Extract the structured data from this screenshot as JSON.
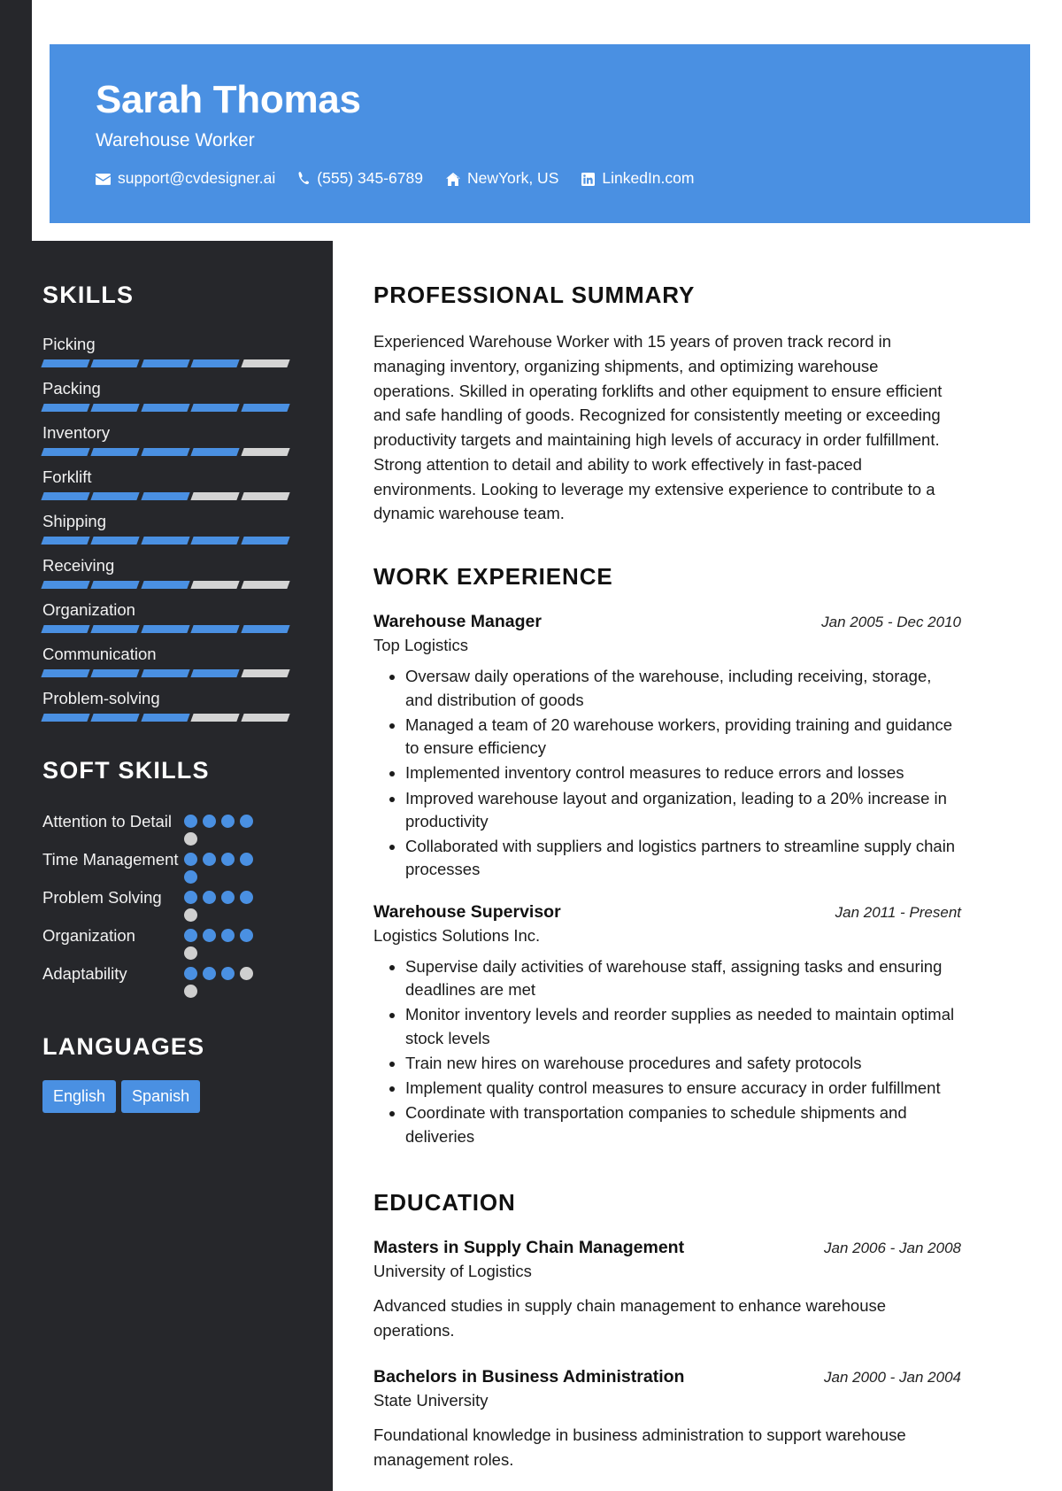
{
  "theme": {
    "accent": "#4a90e2",
    "sidebar_bg": "#26272b",
    "sheet_bg": "#ffffff",
    "bar_empty": "#d4d4d4",
    "dot_empty": "#cfcfcf"
  },
  "header": {
    "name": "Sarah Thomas",
    "role": "Warehouse Worker",
    "contacts": [
      {
        "icon": "envelope-icon",
        "text": "support@cvdesigner.ai"
      },
      {
        "icon": "phone-icon",
        "text": "(555) 345-6789"
      },
      {
        "icon": "home-icon",
        "text": "NewYork, US"
      },
      {
        "icon": "linkedin-icon",
        "text": "LinkedIn.com"
      }
    ]
  },
  "sidebar": {
    "skills_title": "SKILLS",
    "skills": [
      {
        "name": "Picking",
        "level": 4,
        "max": 5
      },
      {
        "name": "Packing",
        "level": 5,
        "max": 5
      },
      {
        "name": "Inventory",
        "level": 4,
        "max": 5
      },
      {
        "name": "Forklift",
        "level": 3,
        "max": 5
      },
      {
        "name": "Shipping",
        "level": 5,
        "max": 5
      },
      {
        "name": "Receiving",
        "level": 3,
        "max": 5
      },
      {
        "name": "Organization",
        "level": 5,
        "max": 5
      },
      {
        "name": "Communication",
        "level": 4,
        "max": 5
      },
      {
        "name": "Problem-solving",
        "level": 3,
        "max": 5
      }
    ],
    "soft_skills_title": "SOFT SKILLS",
    "soft_skills": [
      {
        "name": "Attention to Detail",
        "level": 4,
        "max": 5
      },
      {
        "name": "Time Management",
        "level": 5,
        "max": 5
      },
      {
        "name": "Problem Solving",
        "level": 4,
        "max": 5
      },
      {
        "name": "Organization",
        "level": 4,
        "max": 5
      },
      {
        "name": "Adaptability",
        "level": 3,
        "max": 5
      }
    ],
    "languages_title": "LANGUAGES",
    "languages": [
      "English",
      "Spanish"
    ]
  },
  "main": {
    "summary_title": "PROFESSIONAL SUMMARY",
    "summary_text": "Experienced Warehouse Worker with 15 years of proven track record in managing inventory, organizing shipments, and optimizing warehouse operations. Skilled in operating forklifts and other equipment to ensure efficient and safe handling of goods. Recognized for consistently meeting or exceeding productivity targets and maintaining high levels of accuracy in order fulfillment. Strong attention to detail and ability to work effectively in fast-paced environments. Looking to leverage my extensive experience to contribute to a dynamic warehouse team.",
    "work_title": "WORK EXPERIENCE",
    "work": [
      {
        "title": "Warehouse Manager",
        "date": "Jan 2005 - Dec 2010",
        "org": "Top Logistics",
        "bullets": [
          "Oversaw daily operations of the warehouse, including receiving, storage, and distribution of goods",
          "Managed a team of 20 warehouse workers, providing training and guidance to ensure efficiency",
          "Implemented inventory control measures to reduce errors and losses",
          "Improved warehouse layout and organization, leading to a 20% increase in productivity",
          "Collaborated with suppliers and logistics partners to streamline supply chain processes"
        ]
      },
      {
        "title": "Warehouse Supervisor",
        "date": "Jan 2011 - Present",
        "org": "Logistics Solutions Inc.",
        "bullets": [
          "Supervise daily activities of warehouse staff, assigning tasks and ensuring deadlines are met",
          "Monitor inventory levels and reorder supplies as needed to maintain optimal stock levels",
          "Train new hires on warehouse procedures and safety protocols",
          "Implement quality control measures to ensure accuracy in order fulfillment",
          "Coordinate with transportation companies to schedule shipments and deliveries"
        ]
      }
    ],
    "education_title": "EDUCATION",
    "education": [
      {
        "title": "Masters in Supply Chain Management",
        "date": "Jan 2006 - Jan 2008",
        "org": "University of Logistics",
        "desc": "Advanced studies in supply chain management to enhance warehouse operations."
      },
      {
        "title": "Bachelors in Business Administration",
        "date": "Jan 2000 - Jan 2004",
        "org": "State University",
        "desc": "Foundational knowledge in business administration to support warehouse management roles."
      }
    ]
  }
}
